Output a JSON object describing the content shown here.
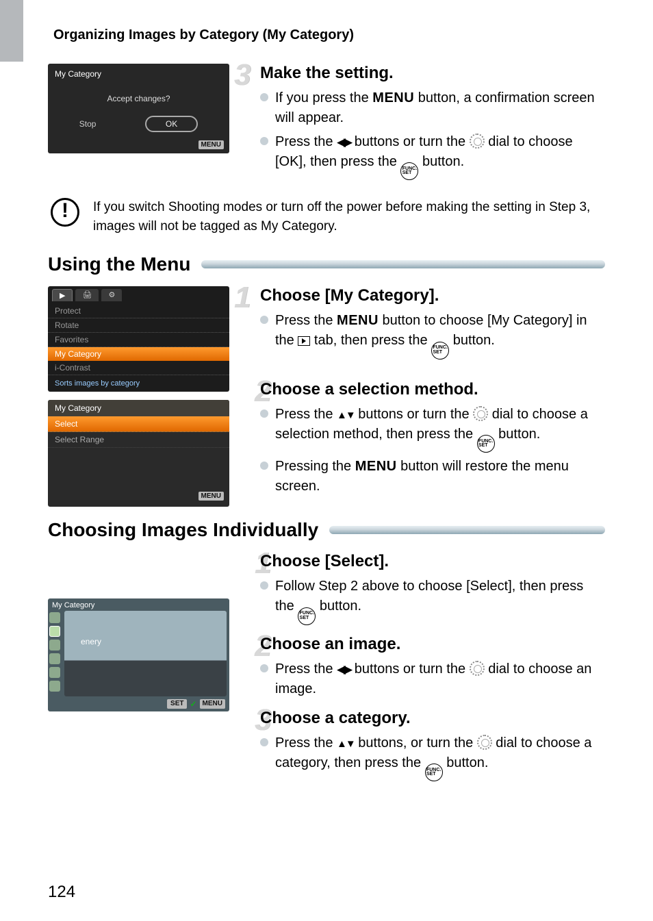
{
  "header": {
    "title": "Organizing Images by Category (My Category)"
  },
  "screenshot1": {
    "title": "My Category",
    "prompt": "Accept changes?",
    "stop": "Stop",
    "ok": "OK",
    "menu_badge": "MENU"
  },
  "step3": {
    "num": "3",
    "title": "Make the setting.",
    "bullet1a": "If you press the ",
    "menu_word": "MENU",
    "bullet1b": " button, a confirmation screen will appear.",
    "bullet2a": "Press the ",
    "bullet2b": " buttons or turn the ",
    "bullet2c": " dial to choose [OK], then press the ",
    "bullet2d": " button."
  },
  "note": {
    "text": "If you switch Shooting modes or turn off the power before making the setting in Step 3, images will not be tagged as My Category."
  },
  "section1": {
    "title": "Using the Menu"
  },
  "menu_ss": {
    "tab1": "▶",
    "tab2": "🖨",
    "tab3": "⚙",
    "items": [
      "Protect",
      "Rotate",
      "Favorites",
      "My Category",
      "i-Contrast"
    ],
    "help": "Sorts images by category"
  },
  "list_ss": {
    "title": "My Category",
    "items": [
      "Select",
      "Select Range"
    ],
    "menu_badge": "MENU"
  },
  "s1step1": {
    "num": "1",
    "title": "Choose [My Category].",
    "b1a": "Press the ",
    "menu_word": "MENU",
    "b1b": " button to choose [My Category] in the ",
    "b1c": " tab, then press the ",
    "b1d": " button."
  },
  "s1step2": {
    "num": "2",
    "title": "Choose a selection method.",
    "b1a": "Press the ",
    "b1b": " buttons or turn the ",
    "b1c": " dial to choose a selection method, then press the ",
    "b1d": " button.",
    "b2a": "Pressing the ",
    "menu_word": "MENU",
    "b2b": " button will restore the menu screen."
  },
  "section2": {
    "title": "Choosing Images Individually"
  },
  "s2step1": {
    "num": "1",
    "title": "Choose [Select].",
    "b1a": "Follow Step 2 above to choose [Select], then press the ",
    "b1b": " button."
  },
  "img_ss": {
    "title": "My Category",
    "label": "enery",
    "set": "SET",
    "check": "✓",
    "menu": "MENU"
  },
  "s2step2": {
    "num": "2",
    "title": "Choose an image.",
    "b1a": "Press the ",
    "b1b": " buttons or turn the ",
    "b1c": " dial to choose an image."
  },
  "s2step3": {
    "num": "3",
    "title": "Choose a category.",
    "b1a": "Press the ",
    "b1b": " buttons, or turn the ",
    "b1c": " dial to choose a category, then press the ",
    "b1d": " button."
  },
  "page_number": "124"
}
